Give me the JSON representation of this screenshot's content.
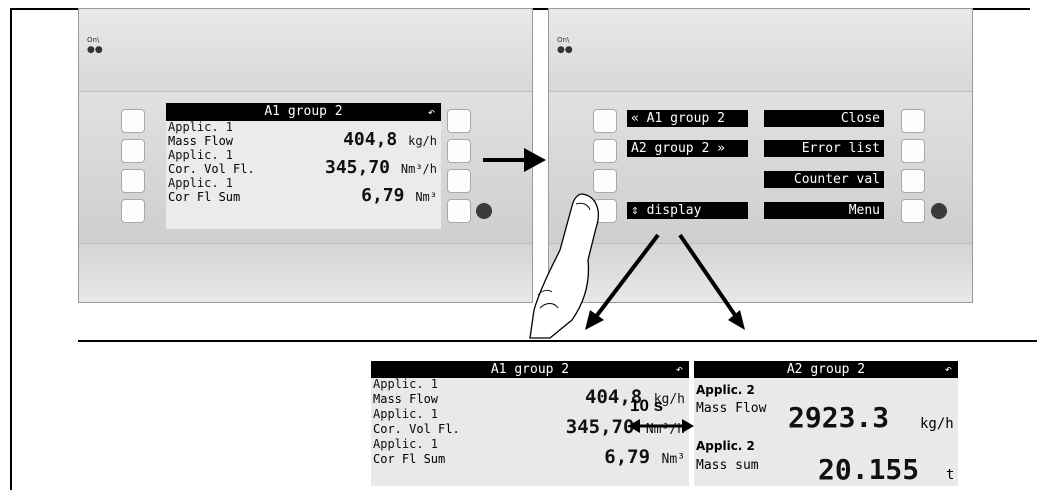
{
  "device_left": {
    "screen": {
      "title": "A1 group 2",
      "back_icon": "↶",
      "rows": [
        {
          "app": "Applic. 1",
          "name": "Mass Flow",
          "value": "404,8",
          "unit": "kg/h"
        },
        {
          "app": "Applic. 1",
          "name": "Cor. Vol Fl.",
          "value": "345,70",
          "unit": "Nm³/h"
        },
        {
          "app": "Applic. 1",
          "name": "Cor Fl Sum",
          "value": "6,79",
          "unit": "Nm³"
        }
      ]
    },
    "led_label": "On\\"
  },
  "device_right": {
    "led_label": "On\\",
    "menu": {
      "left": [
        "« A1 group 2",
        "A2 group 2 »",
        "",
        "⇕ display"
      ],
      "right": [
        "Close",
        "Error list",
        "Counter val",
        "Menu"
      ]
    }
  },
  "detail_left": {
    "title": "A1 group 2",
    "back_icon": "↶",
    "rows": [
      {
        "app": "Applic. 1",
        "name": "Mass Flow",
        "value": "404,8",
        "unit": "kg/h"
      },
      {
        "app": "Applic. 1",
        "name": "Cor. Vol Fl.",
        "value": "345,70",
        "unit": "Nm³/h"
      },
      {
        "app": "Applic. 1",
        "name": "Cor Fl Sum",
        "value": "6,79",
        "unit": "Nm³"
      }
    ]
  },
  "detail_right": {
    "title": "A2 group 2",
    "back_icon": "↶",
    "rows": [
      {
        "app": "Applic. 2",
        "name": "Mass Flow",
        "value": "2923.3",
        "unit": "kg/h"
      },
      {
        "app": "Applic. 2",
        "name": "Mass sum",
        "value": "20.155",
        "unit": "t"
      }
    ]
  },
  "interval_label": "10 s"
}
